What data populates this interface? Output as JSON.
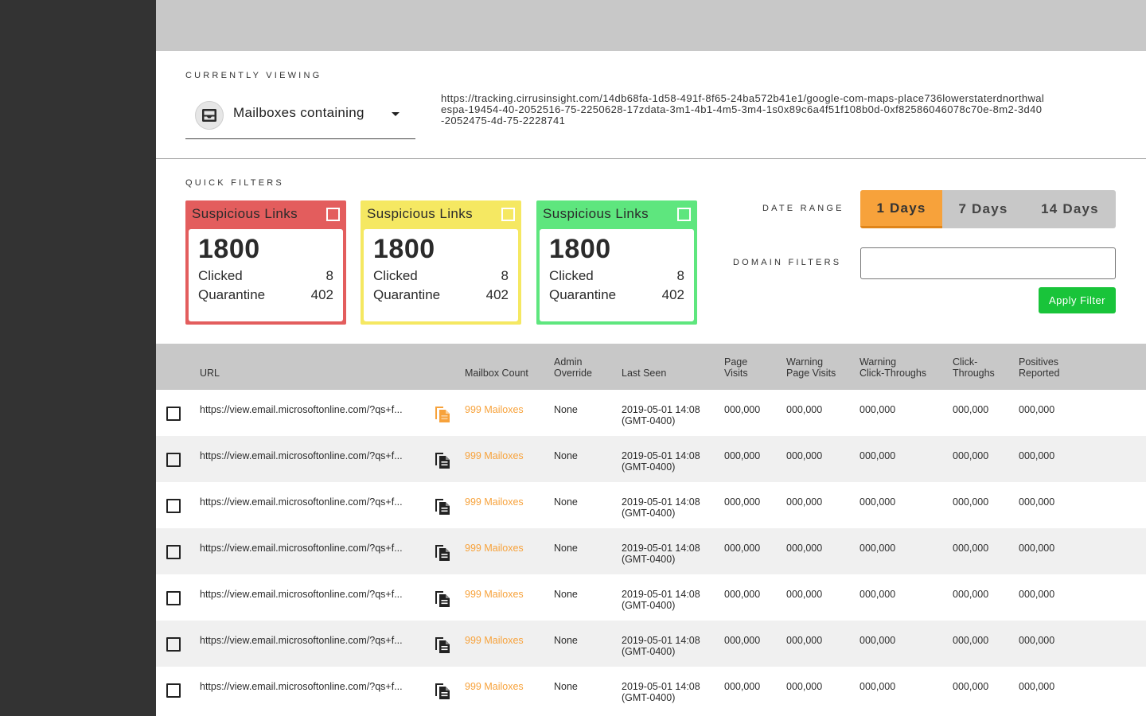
{
  "currently_viewing": {
    "label": "CURRENTLY VIEWING",
    "selected": "Mailboxes containing",
    "tracking_url": "https://tracking.cirrusinsight.com/14db68fa-1d58-491f-8f65-24ba572b41e1/google-com-maps-place736lowerstaterdnorthwalespa-19454-40-2052516-75-2250628-17zdata-3m1-4b1-4m5-3m4-1s0x89c6a4f51f108b0d-0xf82586046078c70e-8m2-3d40-2052475-4d-75-2228741"
  },
  "quick_filters": {
    "label": "QUICK FILTERS",
    "cards": [
      {
        "title": "Suspicious Links",
        "count": "1800",
        "clicked_label": "Clicked",
        "clicked": "8",
        "quarantine_label": "Quarantine",
        "quarantine": "402",
        "color": "#e35d5d"
      },
      {
        "title": "Suspicious Links",
        "count": "1800",
        "clicked_label": "Clicked",
        "clicked": "8",
        "quarantine_label": "Quarantine",
        "quarantine": "402",
        "color": "#f5e862"
      },
      {
        "title": "Suspicious Links",
        "count": "1800",
        "clicked_label": "Clicked",
        "clicked": "8",
        "quarantine_label": "Quarantine",
        "quarantine": "402",
        "color": "#5ee67e"
      }
    ]
  },
  "date_range": {
    "label": "DATE RANGE",
    "options": [
      "1 Days",
      "7 Days",
      "14 Days"
    ],
    "selected": "1 Days"
  },
  "domain_filters": {
    "label": "DOMAIN FILTERS",
    "value": "",
    "apply_label": "Apply Filter"
  },
  "colors": {
    "accent_orange": "#f7a23b",
    "apply_green": "#19c43a",
    "sidebar": "#333333",
    "header_gray": "#c8c8c8"
  },
  "table": {
    "columns": {
      "url": "URL",
      "mailbox_count": "Mailbox Count",
      "admin_override": "Admin\nOverride",
      "last_seen": "Last Seen",
      "page_visits": "Page\nVisits",
      "warning_page_visits": "Warning\nPage Visits",
      "warning_click_throughs": "Warning\nClick-Throughs",
      "click_throughs": "Click-\nThroughs",
      "positives_reported": "Positives\nReported"
    },
    "rows": [
      {
        "url": "https://view.email.microsoftonline.com/?qs+f...",
        "mailbox_count": "999 Mailoxes",
        "admin_override": "None",
        "last_seen": "2019-05-01 14:08\n(GMT-0400)",
        "page_visits": "000,000",
        "warning_page_visits": "000,000",
        "warning_click_throughs": "000,000",
        "click_throughs": "000,000",
        "positives_reported": "000,000",
        "icon": "copy-icon-orange"
      },
      {
        "url": "https://view.email.microsoftonline.com/?qs+f...",
        "mailbox_count": "999 Mailoxes",
        "admin_override": "None",
        "last_seen": "2019-05-01 14:08\n(GMT-0400)",
        "page_visits": "000,000",
        "warning_page_visits": "000,000",
        "warning_click_throughs": "000,000",
        "click_throughs": "000,000",
        "positives_reported": "000,000",
        "icon": "copy-icon"
      },
      {
        "url": "https://view.email.microsoftonline.com/?qs+f...",
        "mailbox_count": "999 Mailoxes",
        "admin_override": "None",
        "last_seen": "2019-05-01 14:08\n(GMT-0400)",
        "page_visits": "000,000",
        "warning_page_visits": "000,000",
        "warning_click_throughs": "000,000",
        "click_throughs": "000,000",
        "positives_reported": "000,000",
        "icon": "copy-icon"
      },
      {
        "url": "https://view.email.microsoftonline.com/?qs+f...",
        "mailbox_count": "999 Mailoxes",
        "admin_override": "None",
        "last_seen": "2019-05-01 14:08\n(GMT-0400)",
        "page_visits": "000,000",
        "warning_page_visits": "000,000",
        "warning_click_throughs": "000,000",
        "click_throughs": "000,000",
        "positives_reported": "000,000",
        "icon": "copy-icon"
      },
      {
        "url": "https://view.email.microsoftonline.com/?qs+f...",
        "mailbox_count": "999 Mailoxes",
        "admin_override": "None",
        "last_seen": "2019-05-01 14:08\n(GMT-0400)",
        "page_visits": "000,000",
        "warning_page_visits": "000,000",
        "warning_click_throughs": "000,000",
        "click_throughs": "000,000",
        "positives_reported": "000,000",
        "icon": "copy-icon"
      },
      {
        "url": "https://view.email.microsoftonline.com/?qs+f...",
        "mailbox_count": "999 Mailoxes",
        "admin_override": "None",
        "last_seen": "2019-05-01 14:08\n(GMT-0400)",
        "page_visits": "000,000",
        "warning_page_visits": "000,000",
        "warning_click_throughs": "000,000",
        "click_throughs": "000,000",
        "positives_reported": "000,000",
        "icon": "copy-icon"
      },
      {
        "url": "https://view.email.microsoftonline.com/?qs+f...",
        "mailbox_count": "999 Mailoxes",
        "admin_override": "None",
        "last_seen": "2019-05-01 14:08\n(GMT-0400)",
        "page_visits": "000,000",
        "warning_page_visits": "000,000",
        "warning_click_throughs": "000,000",
        "click_throughs": "000,000",
        "positives_reported": "000,000",
        "icon": "copy-icon"
      }
    ]
  }
}
